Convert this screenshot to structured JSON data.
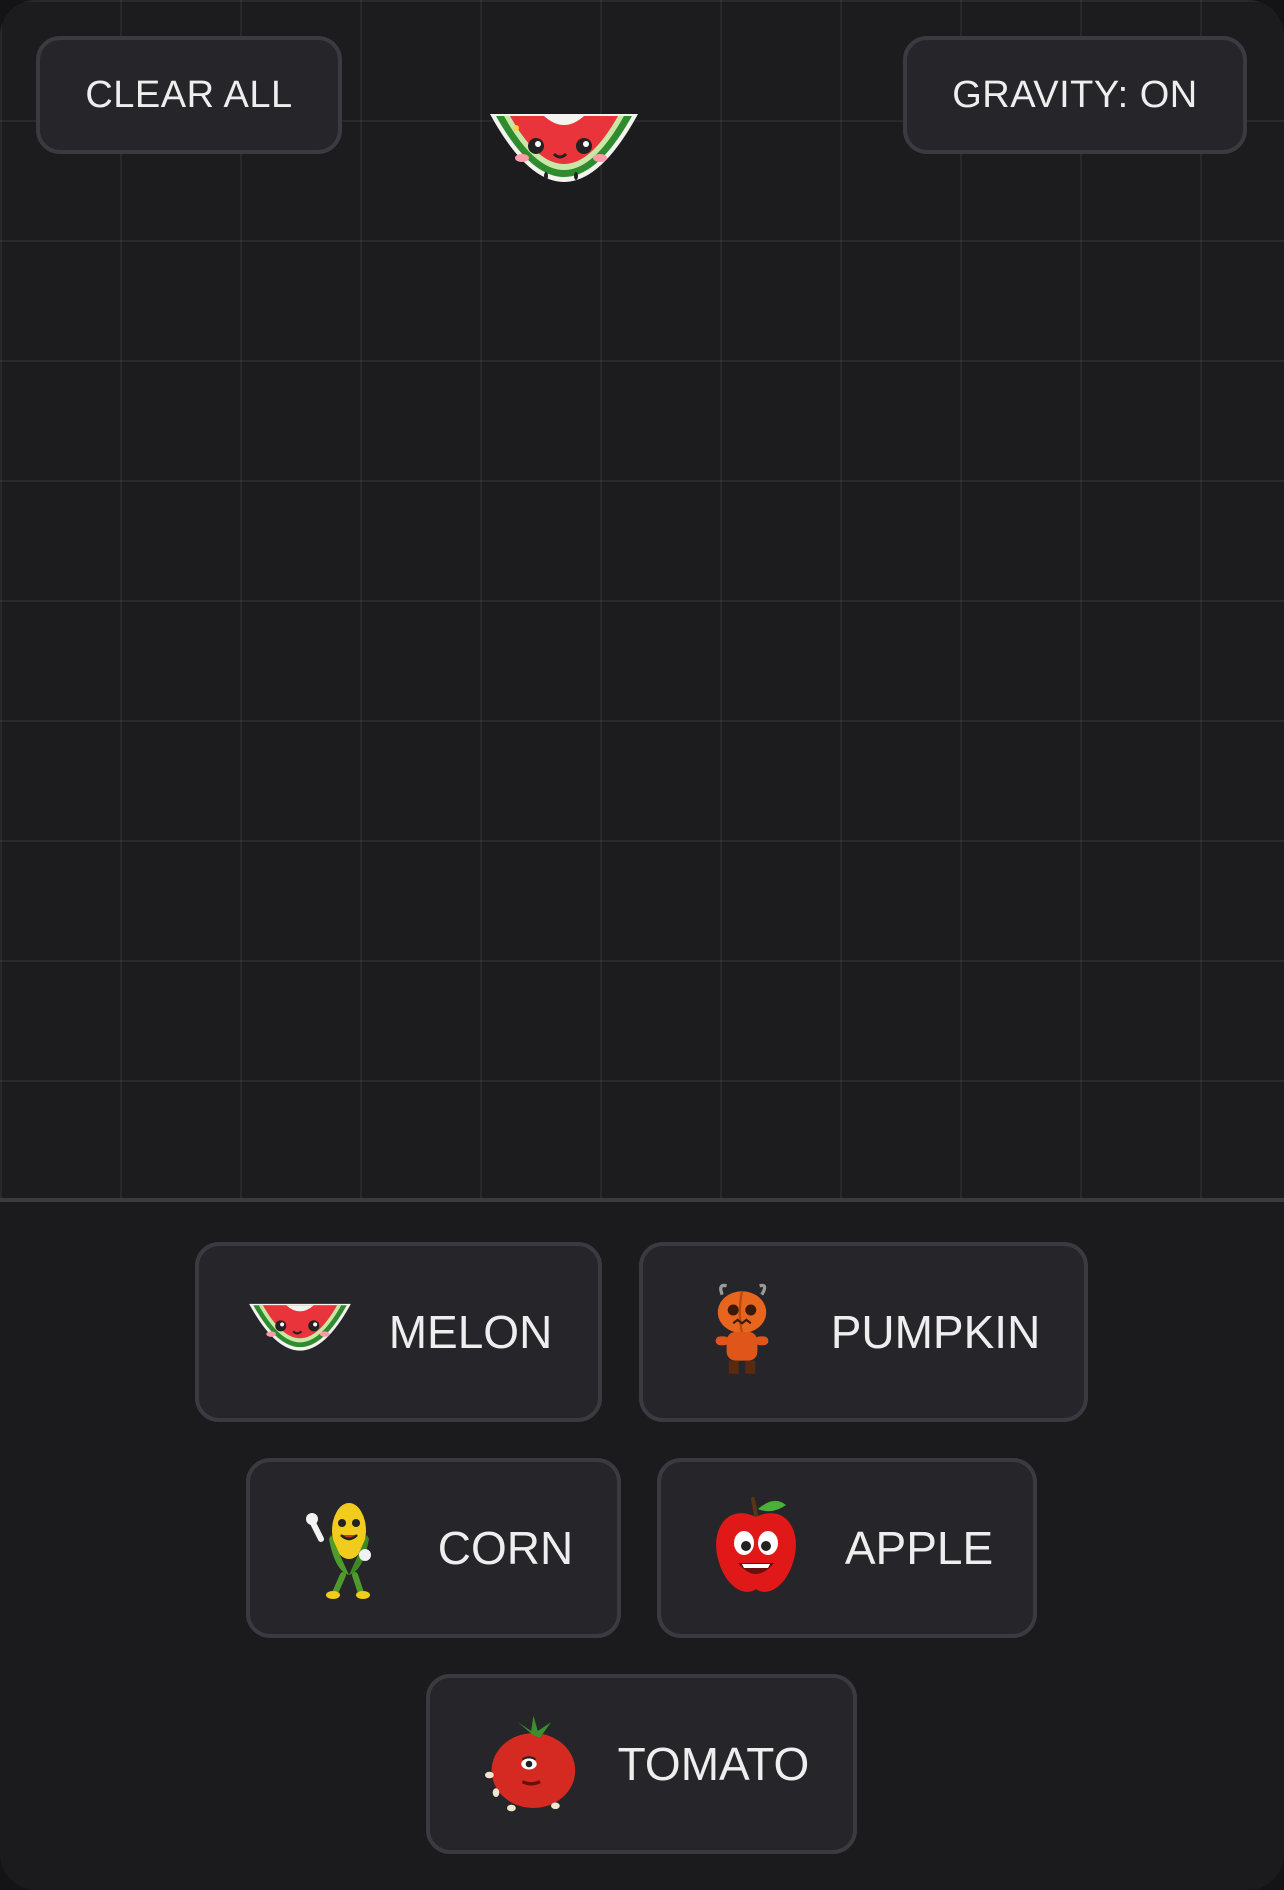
{
  "controls": {
    "clear_label": "CLEAR ALL",
    "gravity_label": "GRAVITY: ON"
  },
  "playfield": {
    "items": [
      {
        "kind": "melon",
        "icon": "watermelon-icon"
      }
    ]
  },
  "spawn_buttons": [
    {
      "label": "MELON",
      "icon": "watermelon-icon"
    },
    {
      "label": "PUMPKIN",
      "icon": "pumpkin-character-icon"
    },
    {
      "label": "CORN",
      "icon": "corn-character-icon"
    },
    {
      "label": "APPLE",
      "icon": "apple-character-icon"
    },
    {
      "label": "TOMATO",
      "icon": "tomato-character-icon"
    }
  ],
  "colors": {
    "background": "#1b1b1e",
    "button_bg": "#26262a",
    "button_border": "#3a3a40",
    "text": "#eeeeee"
  }
}
